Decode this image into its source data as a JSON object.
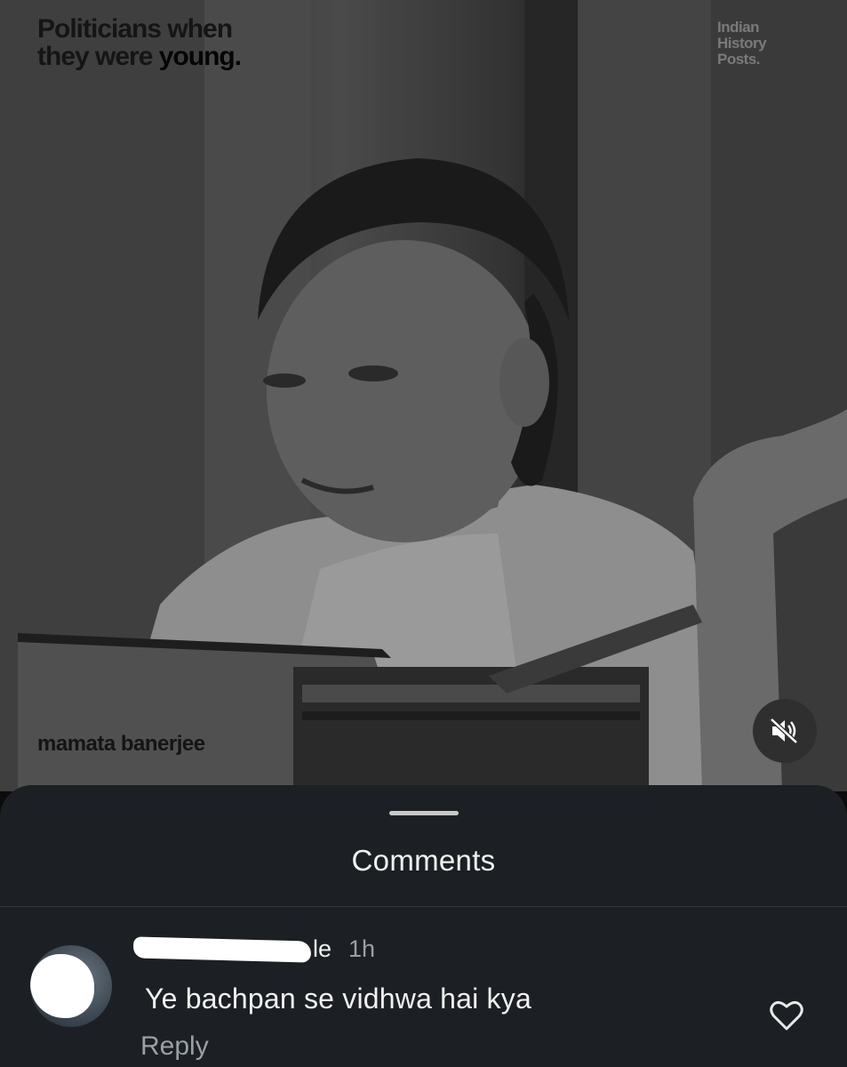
{
  "post": {
    "title_line1": "Politicians when",
    "title_line2_prefix": "they were ",
    "title_line2_highlight": "young.",
    "brand_line1": "Indian",
    "brand_line2": "History",
    "brand_line3": "Posts.",
    "person_name": "mamata banerjee",
    "mute_icon": "speaker-muted-icon"
  },
  "comments_sheet": {
    "title": "Comments",
    "comments": [
      {
        "username_visible_tail": "le",
        "timestamp": "1h",
        "text": "Ye bachpan se vidhwa hai kya",
        "reply_label": "Reply",
        "like_icon": "heart-outline-icon"
      }
    ]
  },
  "colors": {
    "sheet_background": "#1c2024",
    "primary_text": "#f1f1f1",
    "secondary_text": "#9aa0a6"
  }
}
